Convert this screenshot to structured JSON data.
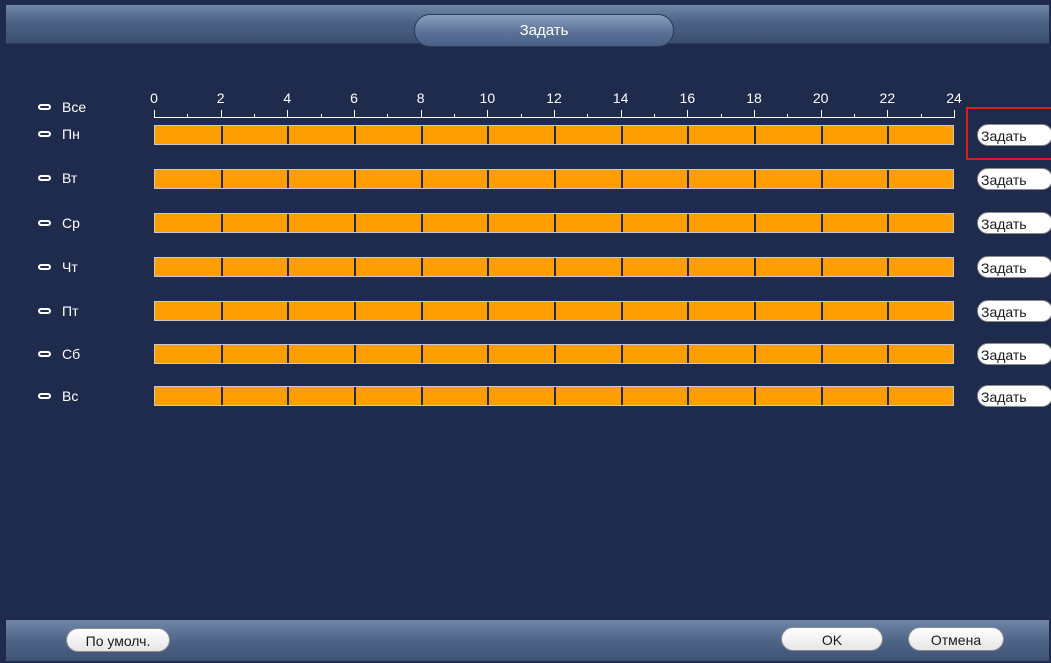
{
  "dialog": {
    "title": "Задать"
  },
  "schedule": {
    "scale_labels": [
      "0",
      "2",
      "4",
      "6",
      "8",
      "10",
      "12",
      "14",
      "16",
      "18",
      "20",
      "22",
      "24"
    ],
    "all_label": "Все",
    "days": [
      {
        "label": "Пн",
        "set_label": "Задать"
      },
      {
        "label": "Вт",
        "set_label": "Задать"
      },
      {
        "label": "Ср",
        "set_label": "Задать"
      },
      {
        "label": "Чт",
        "set_label": "Задать"
      },
      {
        "label": "Пт",
        "set_label": "Задать"
      },
      {
        "label": "Сб",
        "set_label": "Задать"
      },
      {
        "label": "Вс",
        "set_label": "Задать"
      }
    ],
    "active_color": "#ff9e00",
    "highlight_color": "#d81e1e"
  },
  "footer": {
    "default_label": "По умолч.",
    "ok_label": "OK",
    "cancel_label": "Отмена"
  }
}
